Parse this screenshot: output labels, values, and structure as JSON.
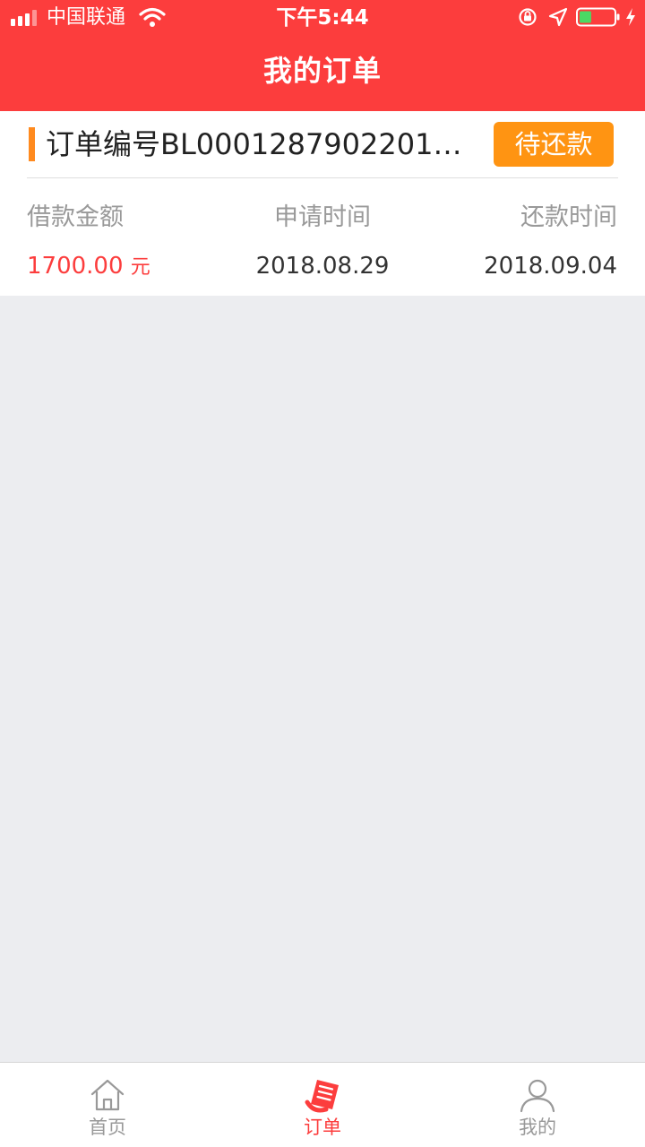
{
  "status_bar": {
    "carrier": "中国联通",
    "time": "下午5:44"
  },
  "header": {
    "title": "我的订单"
  },
  "order": {
    "number": "订单编号BL00012879022018...",
    "status_label": "待还款",
    "columns": {
      "amount_label": "借款金额",
      "apply_time_label": "申请时间",
      "repay_time_label": "还款时间"
    },
    "amount": "1700.00",
    "amount_unit": "元",
    "apply_time": "2018.08.29",
    "repay_time": "2018.09.04"
  },
  "tabbar": {
    "home_label": "首页",
    "orders_label": "订单",
    "mine_label": "我的"
  },
  "colors": {
    "brand_red": "#fc3d3d",
    "status_orange": "#ff9412",
    "accent_orange": "#ff8a1e"
  },
  "icons": {
    "status_bar": [
      "signal-icon",
      "wifi-icon",
      "orientation-lock-icon",
      "location-icon",
      "battery-icon",
      "charging-icon"
    ],
    "tabbar": [
      "home-icon",
      "order-icon",
      "user-icon"
    ]
  },
  "battery_level": 0.35
}
